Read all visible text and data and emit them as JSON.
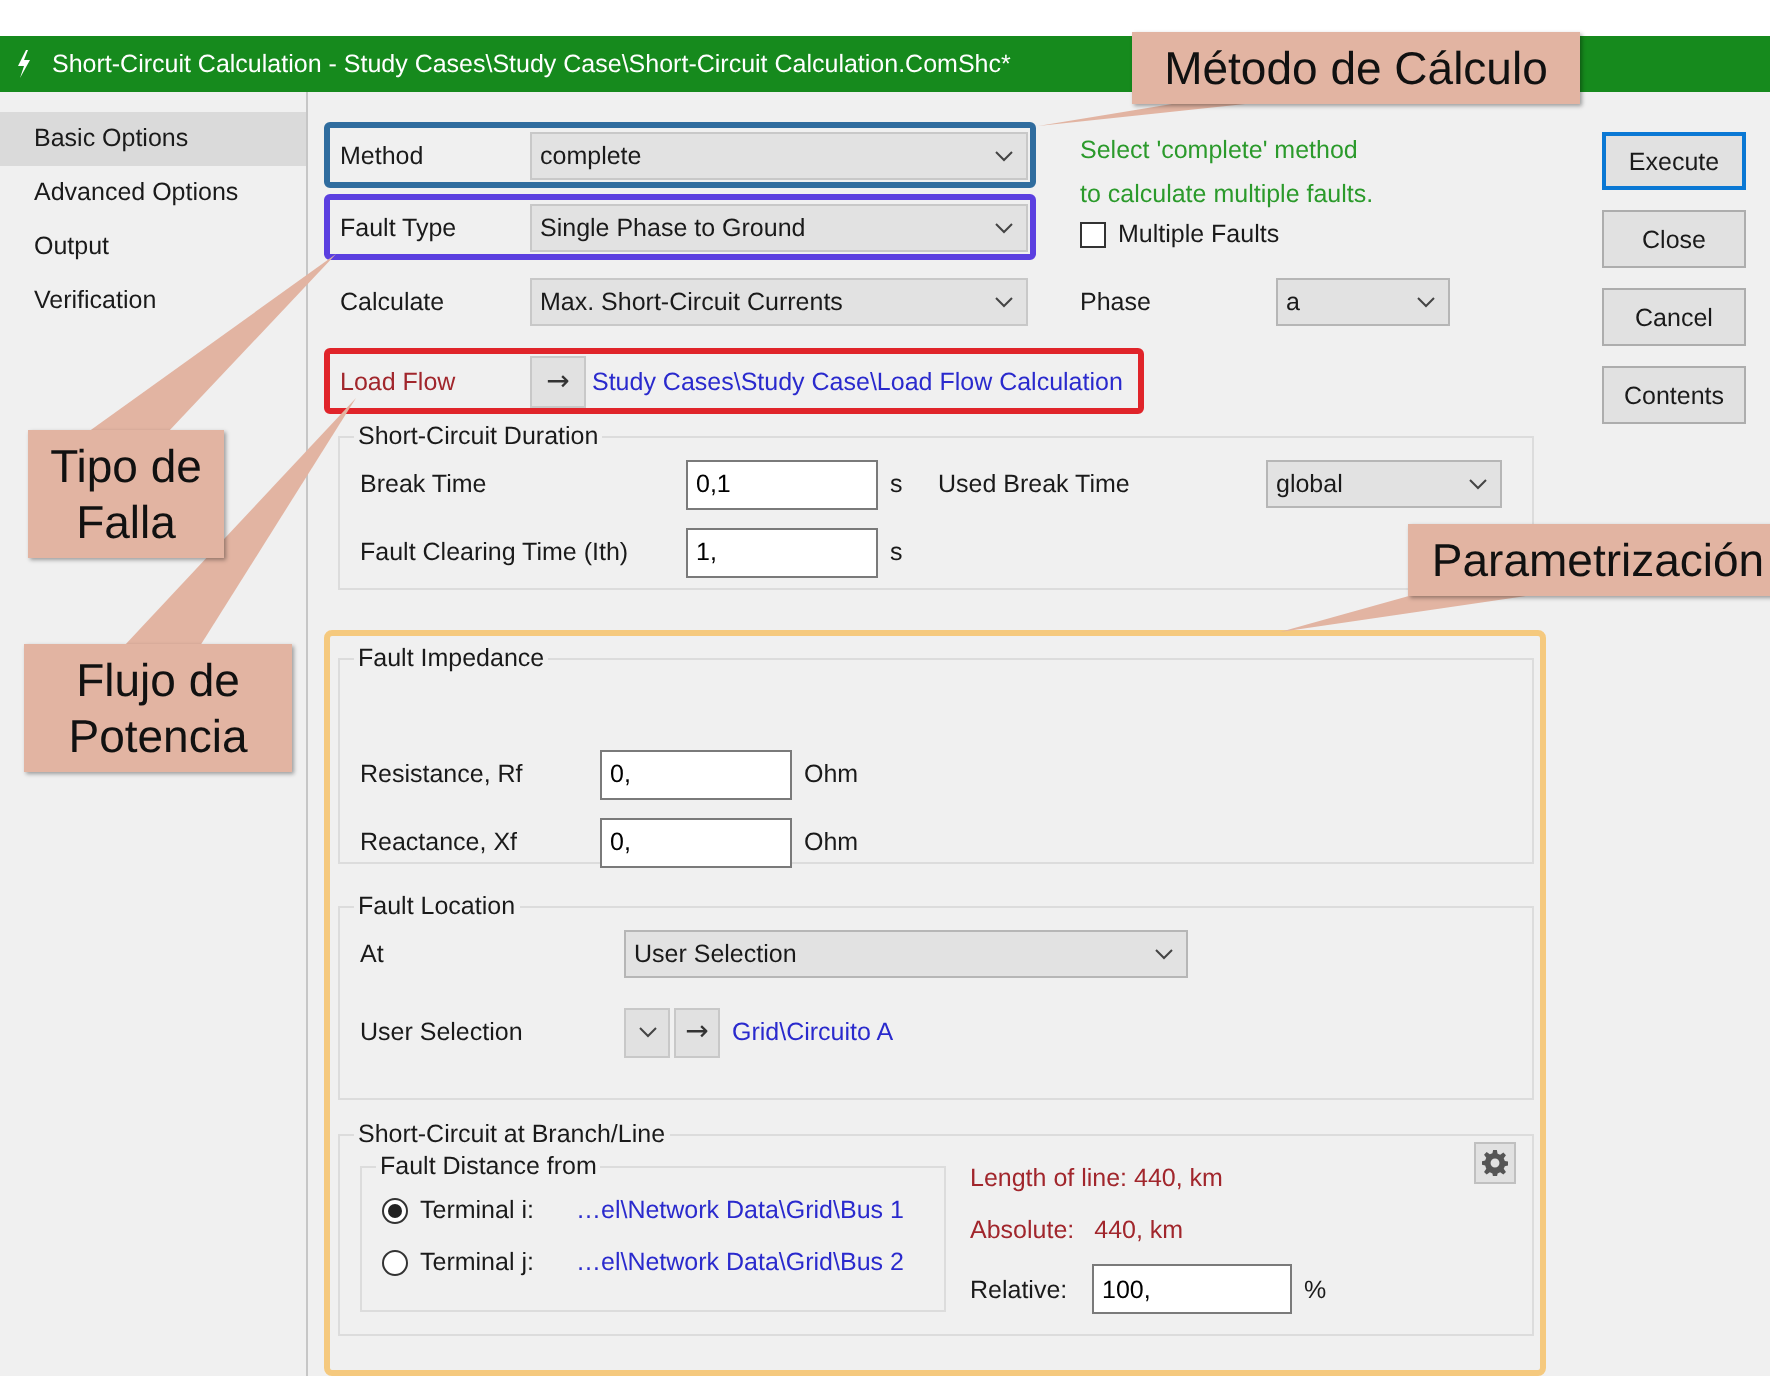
{
  "window": {
    "title": "Short-Circuit Calculation - Study Cases\\Study Case\\Short-Circuit Calculation.ComShc*"
  },
  "sidebar": {
    "items": [
      {
        "label": "Basic Options",
        "selected": true
      },
      {
        "label": "Advanced Options",
        "selected": false
      },
      {
        "label": "Output",
        "selected": false
      },
      {
        "label": "Verification",
        "selected": false
      }
    ]
  },
  "settings": {
    "method": {
      "label": "Method",
      "value": "complete"
    },
    "fault_type": {
      "label": "Fault Type",
      "value": "Single Phase to Ground"
    },
    "calculate": {
      "label": "Calculate",
      "value": "Max. Short-Circuit Currents"
    },
    "load_flow": {
      "label": "Load Flow",
      "arrow": "→",
      "link": "Study Cases\\Study Case\\Load Flow Calculation"
    },
    "hint": [
      "Select 'complete' method",
      "to calculate multiple faults."
    ],
    "multiple_faults": {
      "label": "Multiple Faults",
      "checked": false
    },
    "phase": {
      "label": "Phase",
      "value": "a"
    }
  },
  "duration": {
    "title": "Short-Circuit Duration",
    "break_time": {
      "label": "Break Time",
      "value": "0,1",
      "unit": "s"
    },
    "used_break_time": {
      "label": "Used Break Time",
      "value": "global"
    },
    "clearing_time": {
      "label": "Fault Clearing Time (Ith)",
      "value": "1,",
      "unit": "s"
    }
  },
  "impedance": {
    "title": "Fault Impedance",
    "resistance": {
      "label": "Resistance, Rf",
      "value": "0,",
      "unit": "Ohm"
    },
    "reactance": {
      "label": "Reactance, Xf",
      "value": "0,",
      "unit": "Ohm"
    }
  },
  "location": {
    "title": "Fault Location",
    "at": {
      "label": "At",
      "value": "User Selection"
    },
    "user_selection": {
      "label": "User Selection",
      "arrow": "→",
      "link": "Grid\\Circuito A"
    }
  },
  "branch": {
    "title": "Short-Circuit at Branch/Line",
    "fault_distance": {
      "title": "Fault Distance from",
      "terminals": [
        {
          "label": "Terminal i:",
          "value": "…el\\Network Data\\Grid\\Bus 1",
          "selected": true
        },
        {
          "label": "Terminal j:",
          "value": "…el\\Network Data\\Grid\\Bus 2",
          "selected": false
        }
      ]
    },
    "length": "Length of line: 440, km",
    "absolute": {
      "label": "Absolute:",
      "value": "440, km"
    },
    "relative": {
      "label": "Relative:",
      "value": "100,",
      "unit": "%"
    }
  },
  "buttons": [
    {
      "label": "Execute",
      "default": true
    },
    {
      "label": "Close",
      "default": false
    },
    {
      "label": "Cancel",
      "default": false
    },
    {
      "label": "Contents",
      "default": false
    }
  ],
  "callouts": [
    {
      "text": "Método de Cálculo"
    },
    {
      "text": "Tipo de Falla"
    },
    {
      "text": "Flujo de Potencia"
    },
    {
      "text": "Parametrización"
    }
  ]
}
